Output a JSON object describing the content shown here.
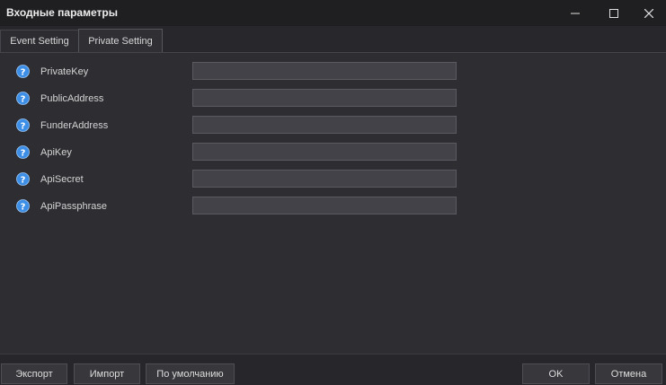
{
  "window": {
    "title": "Входные параметры"
  },
  "tabs": [
    {
      "label": "Event Setting",
      "active": false
    },
    {
      "label": "Private Setting",
      "active": true
    }
  ],
  "fields": [
    {
      "label": "PrivateKey",
      "value": ""
    },
    {
      "label": "PublicAddress",
      "value": ""
    },
    {
      "label": "FunderAddress",
      "value": ""
    },
    {
      "label": "ApiKey",
      "value": ""
    },
    {
      "label": "ApiSecret",
      "value": ""
    },
    {
      "label": "ApiPassphrase",
      "value": ""
    }
  ],
  "footer": {
    "export_label": "Экспорт",
    "import_label": "Импорт",
    "default_label": "По умолчанию",
    "ok_label": "OK",
    "cancel_label": "Отмена"
  },
  "colors": {
    "help_icon": "#3d8ee6",
    "background": "#2d2d32",
    "input_bg": "#424248"
  }
}
